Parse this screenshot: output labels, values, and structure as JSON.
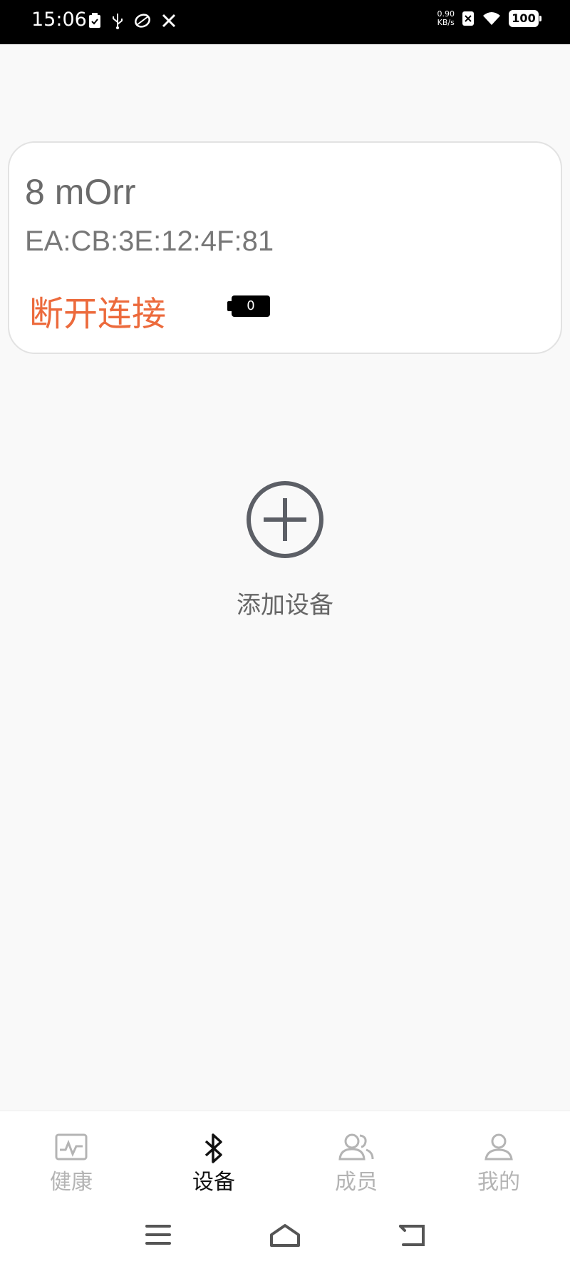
{
  "status_bar": {
    "time": "15:06",
    "speed_value": "0.90",
    "speed_unit": "KB/s",
    "battery": "100",
    "left_icons": [
      "clipboard-icon",
      "usb-icon",
      "sync-icon",
      "tools-icon"
    ],
    "right_icons": [
      "no-sim-icon",
      "wifi-icon",
      "battery-icon"
    ]
  },
  "device_card": {
    "name": "8 mOrr",
    "mac": "EA:CB:3E:12:4F:81",
    "disconnect_label": "断开连接",
    "battery_level": "0",
    "accent_color": "#ec6a3c"
  },
  "add_device": {
    "icon": "plus-circle-icon",
    "label": "添加设备"
  },
  "tabs": [
    {
      "label": "健康",
      "icon": "health-chart-icon",
      "active": false
    },
    {
      "label": "设备",
      "icon": "bluetooth-icon",
      "active": true
    },
    {
      "label": "成员",
      "icon": "members-icon",
      "active": false
    },
    {
      "label": "我的",
      "icon": "profile-icon",
      "active": false
    }
  ],
  "nav_bar": [
    "menu-icon",
    "home-icon",
    "back-icon"
  ]
}
